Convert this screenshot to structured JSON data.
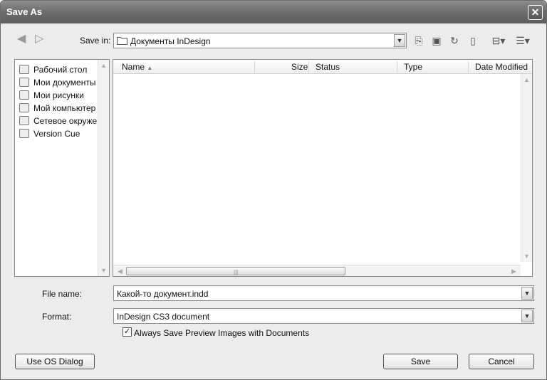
{
  "window": {
    "title": "Save As",
    "close_glyph": "✕"
  },
  "toolbar": {
    "back_icon": "back-arrow-icon",
    "forward_icon": "forward-arrow-icon",
    "save_in_label": "Save in:",
    "save_in_value": "Документы InDesign",
    "icons": [
      "up-folder-icon",
      "new-folder-icon",
      "refresh-icon",
      "delete-icon",
      "tools-menu-icon",
      "view-menu-icon"
    ]
  },
  "places": [
    {
      "label": "Рабочий стол",
      "icon": "desktop-icon"
    },
    {
      "label": "Мои документы",
      "icon": "my-documents-icon"
    },
    {
      "label": "Мои рисунки",
      "icon": "my-pictures-icon"
    },
    {
      "label": "Мой компьютер",
      "icon": "my-computer-icon"
    },
    {
      "label": "Сетевое окружение",
      "icon": "network-icon"
    },
    {
      "label": "Version Cue",
      "icon": "version-cue-icon"
    }
  ],
  "columns": [
    "Name",
    "Size",
    "Status",
    "Type",
    "Date Modified"
  ],
  "file_name": {
    "label": "File name:",
    "value": "Какой-то документ.indd"
  },
  "format": {
    "label": "Format:",
    "value": "InDesign CS3 document"
  },
  "preview_checkbox": {
    "label": "Always Save Preview Images with Documents",
    "checked": true
  },
  "buttons": {
    "os_dialog": "Use OS Dialog",
    "save": "Save",
    "cancel": "Cancel"
  },
  "colors": {
    "titlebar": "#6c6c6c",
    "window_bg": "#ececec"
  }
}
